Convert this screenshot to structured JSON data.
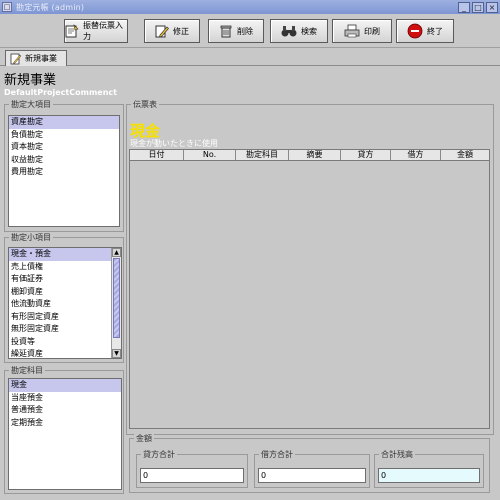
{
  "window": {
    "title": "勘定元帳 (admin)",
    "minimize": "_",
    "maximize": "□",
    "close": "×"
  },
  "toolbar": {
    "transfer_label": "振替伝票入力",
    "edit_label": "修正",
    "delete_label": "削除",
    "search_label": "検索",
    "print_label": "印刷",
    "exit_label": "終了"
  },
  "tab": {
    "label": "新規事業"
  },
  "page": {
    "title": "新規事業",
    "comment": "DefaultProjectCommenct"
  },
  "major": {
    "label": "勘定大項目",
    "items": [
      "資産勘定",
      "負債勘定",
      "資本勘定",
      "収益勘定",
      "費用勘定"
    ]
  },
  "minor": {
    "label": "勘定小項目",
    "items": [
      "現金・預金",
      "売上債権",
      "有価証券",
      "棚卸資産",
      "他流動資産",
      "有形固定資産",
      "無形固定資産",
      "投資等",
      "繰延資産"
    ]
  },
  "subjects": {
    "label": "勘定科目",
    "items": [
      "現金",
      "当座預金",
      "普通預金",
      "定期預金"
    ]
  },
  "voucher": {
    "label": "伝票表",
    "account_name": "現金",
    "account_desc": "現金が動いたときに使用",
    "columns": [
      "日付",
      "No.",
      "勘定科目",
      "摘要",
      "貸方",
      "借方",
      "金額"
    ]
  },
  "summary": {
    "label": "金額",
    "credit_label": "貸方合計",
    "credit_value": "0",
    "debit_label": "借方合計",
    "debit_value": "0",
    "balance_label": "合計残高",
    "balance_value": "0"
  },
  "colors": {
    "title_bar": "#8ea2da",
    "selection": "#c7c7ee",
    "account_name": "#f7e000",
    "exit_icon": "#d01010"
  }
}
